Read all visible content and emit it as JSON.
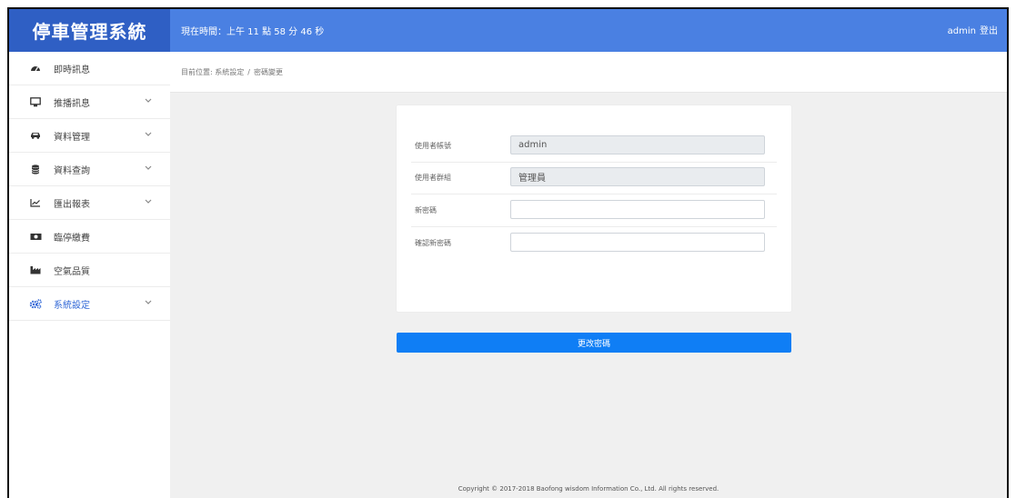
{
  "app": {
    "title": "停車管理系統"
  },
  "header": {
    "clock_text": "現在時間：上午 11 點 58 分 46 秒",
    "username": "admin",
    "logout_label": "登出"
  },
  "sidebar": {
    "items": [
      {
        "label": "即時訊息",
        "icon": "dashboard-icon",
        "has_submenu": false
      },
      {
        "label": "推播訊息",
        "icon": "monitor-icon",
        "has_submenu": true
      },
      {
        "label": "資料管理",
        "icon": "car-icon",
        "has_submenu": true
      },
      {
        "label": "資料查詢",
        "icon": "database-icon",
        "has_submenu": true
      },
      {
        "label": "匯出報表",
        "icon": "line-chart-icon",
        "has_submenu": true
      },
      {
        "label": "臨停繳費",
        "icon": "money-icon",
        "has_submenu": false
      },
      {
        "label": "空氣品質",
        "icon": "industry-icon",
        "has_submenu": false
      },
      {
        "label": "系統設定",
        "icon": "cogs-icon",
        "has_submenu": true,
        "active": true
      }
    ],
    "active_color": "#2f66d6"
  },
  "breadcrumb": {
    "prefix": "目前位置:",
    "section": "系統設定",
    "separator": "/",
    "page": "密碼變更"
  },
  "form": {
    "fields": [
      {
        "label": "使用者帳號",
        "value": "admin",
        "readonly": true
      },
      {
        "label": "使用者群組",
        "value": "管理員",
        "readonly": true
      },
      {
        "label": "新密碼",
        "value": "",
        "readonly": false
      },
      {
        "label": "確認新密碼",
        "value": "",
        "readonly": false
      }
    ],
    "submit_label": "更改密碼"
  },
  "footer": {
    "text": "Copyright © 2017-2018 Baofong wisdom Information Co., Ltd. All rights reserved."
  },
  "colors": {
    "brand": "#2f5fc4",
    "topbar": "#4a80e2",
    "button": "#0f7ef5"
  }
}
